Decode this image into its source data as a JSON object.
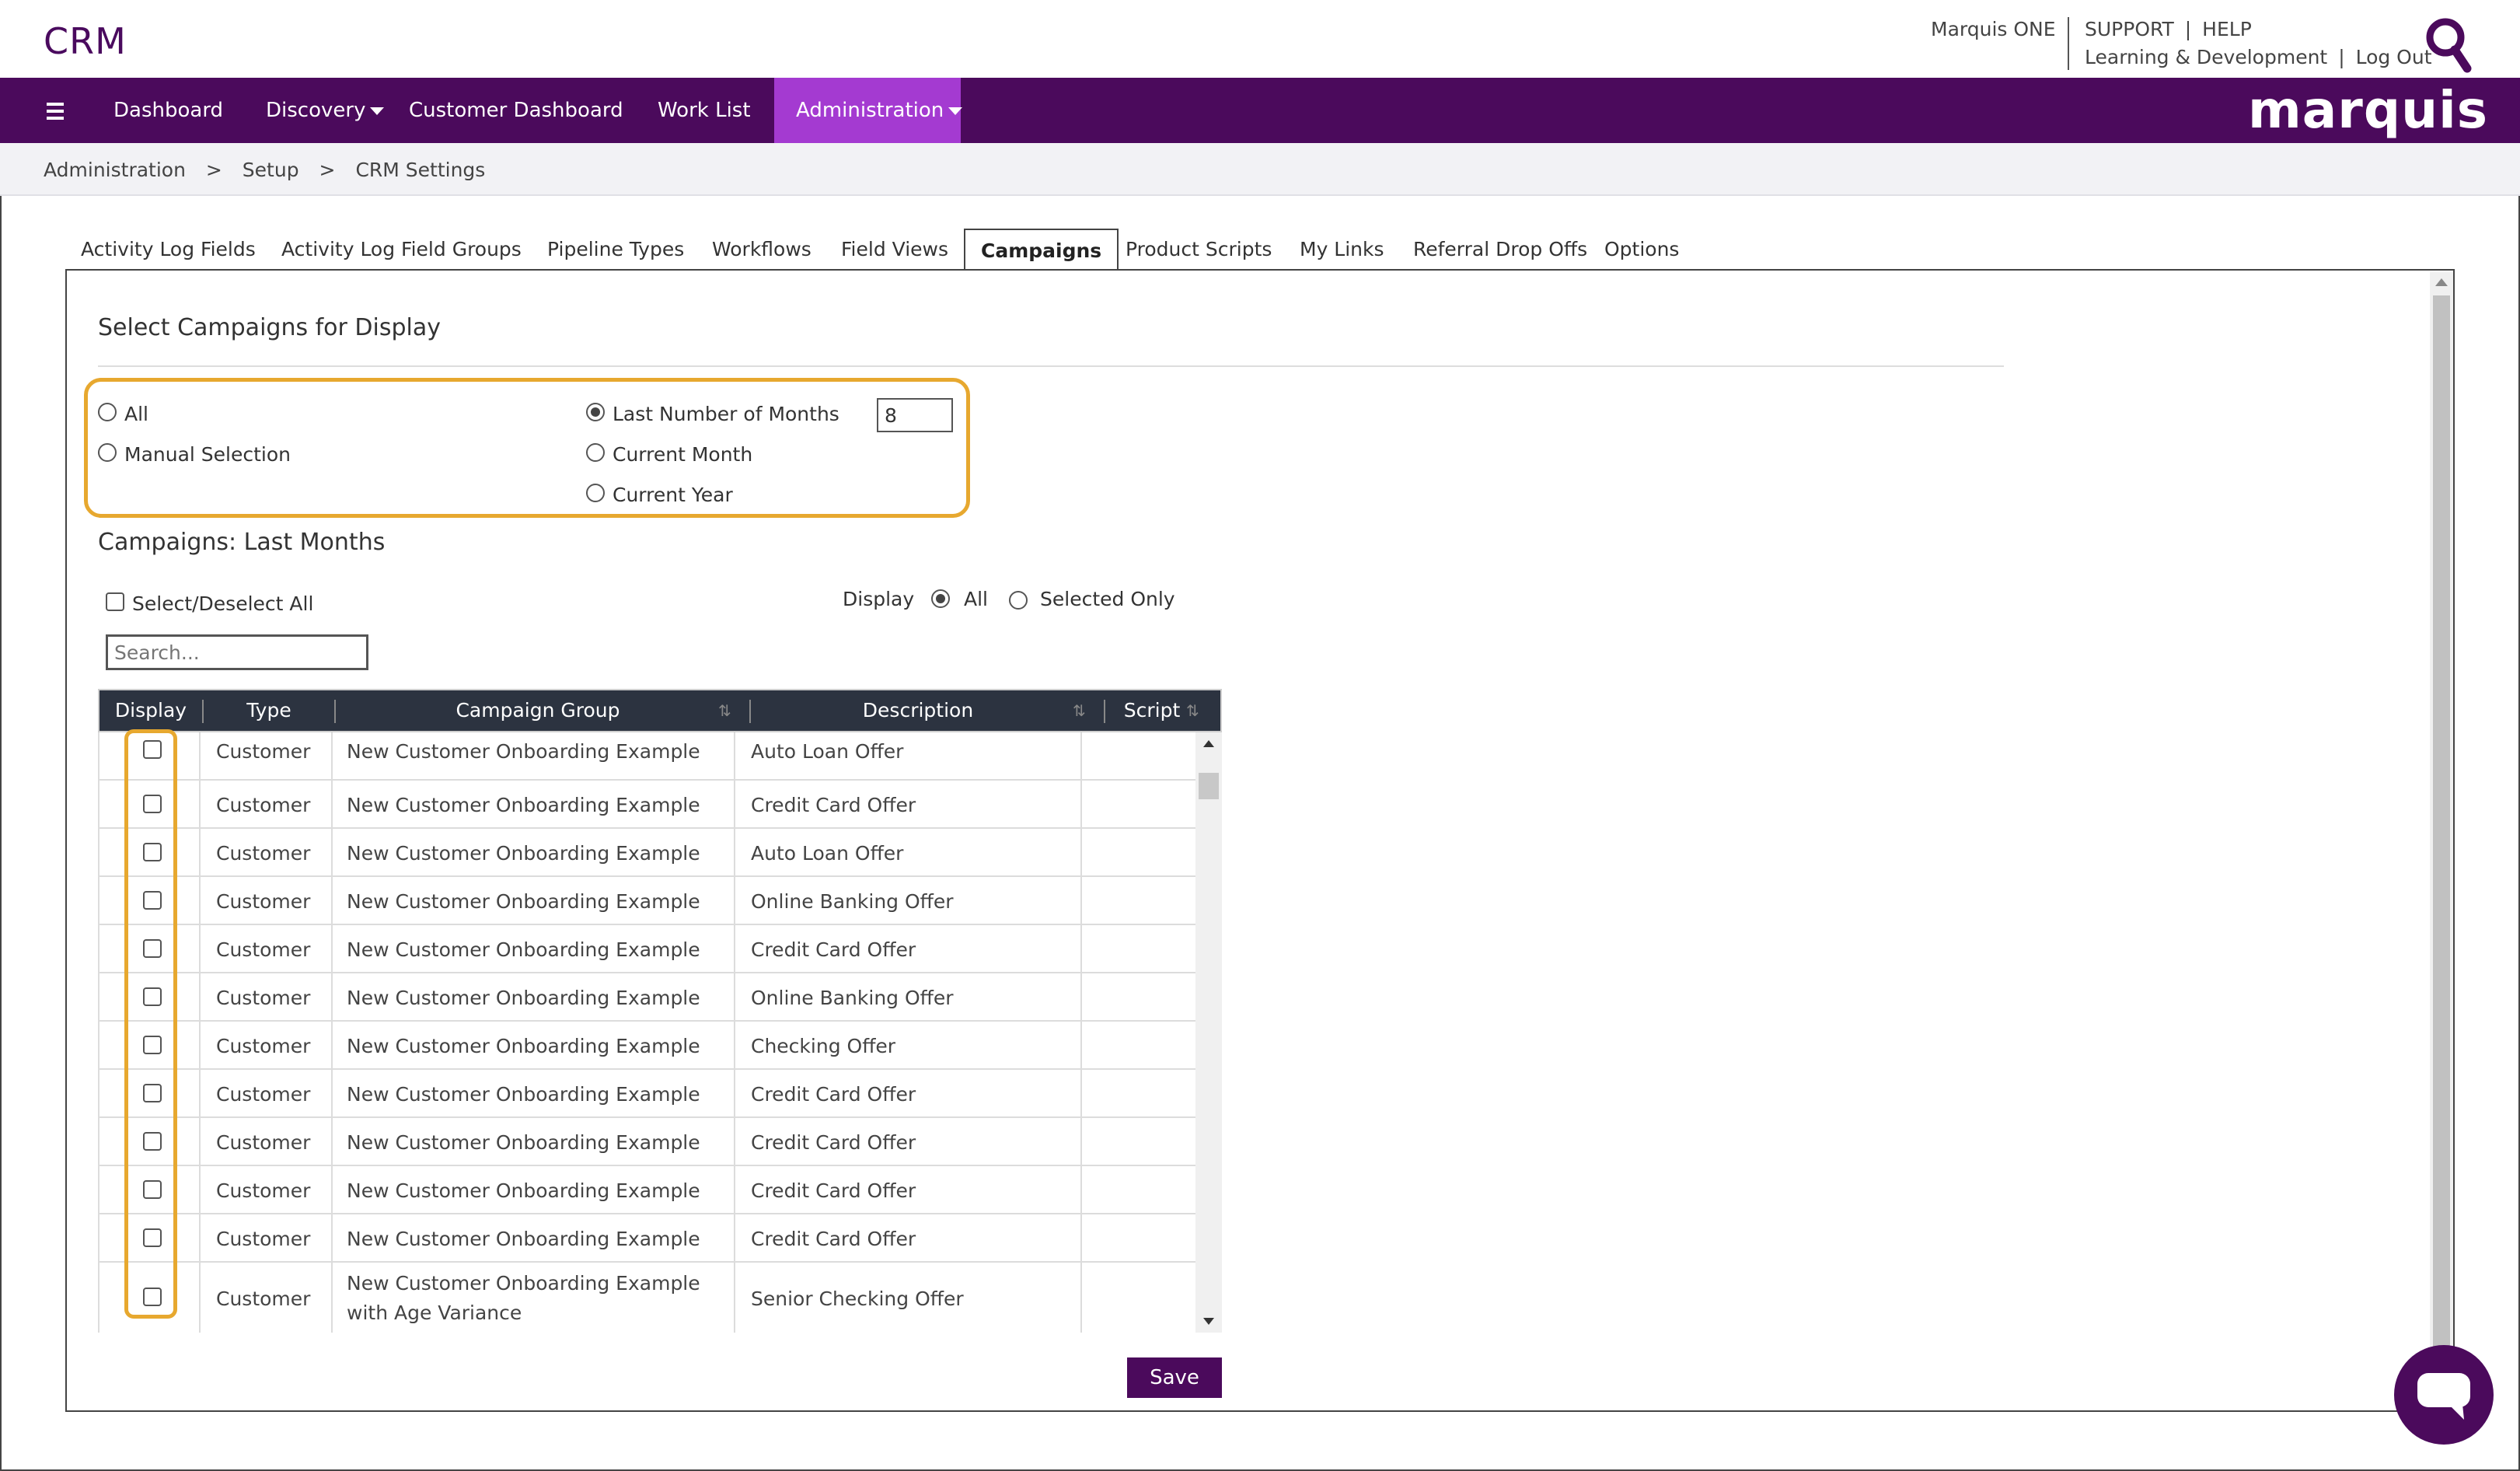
{
  "app": {
    "title": "CRM"
  },
  "top_links": {
    "product": "Marquis ONE",
    "support": "SUPPORT",
    "help": "HELP",
    "learning": "Learning & Development",
    "logout": "Log Out",
    "sep": "|"
  },
  "nav": {
    "items": [
      {
        "label": "Dashboard"
      },
      {
        "label": "Discovery"
      },
      {
        "label": "Customer Dashboard"
      },
      {
        "label": "Work List"
      },
      {
        "label": "Administration"
      }
    ],
    "logo": "marquis"
  },
  "breadcrumb": {
    "items": [
      "Administration",
      "Setup",
      "CRM Settings"
    ],
    "sep": ">"
  },
  "tabs": [
    "Activity Log Fields",
    "Activity Log Field Groups",
    "Pipeline Types",
    "Workflows",
    "Field Views",
    "Campaigns",
    "Product Scripts",
    "My Links",
    "Referral Drop Offs",
    "Options"
  ],
  "section": {
    "title": "Select Campaigns for Display",
    "options": {
      "all": "All",
      "manual": "Manual Selection",
      "last_months": "Last Number of Months",
      "current_month": "Current Month",
      "current_year": "Current Year",
      "months_value": "8"
    }
  },
  "campaigns": {
    "title": "Campaigns: Last Months",
    "select_all": "Select/Deselect All",
    "display_label": "Display",
    "display_all": "All",
    "display_selected": "Selected Only",
    "search_placeholder": "Search...",
    "columns": [
      "Display",
      "Type",
      "Campaign Group",
      "Description",
      "Script"
    ],
    "rows": [
      {
        "type": "Customer",
        "group": "New Customer Onboarding Example",
        "description": "Auto Loan Offer"
      },
      {
        "type": "Customer",
        "group": "New Customer Onboarding Example",
        "description": "Credit Card Offer"
      },
      {
        "type": "Customer",
        "group": "New Customer Onboarding Example",
        "description": "Auto Loan Offer"
      },
      {
        "type": "Customer",
        "group": "New Customer Onboarding Example",
        "description": "Online Banking Offer"
      },
      {
        "type": "Customer",
        "group": "New Customer Onboarding Example",
        "description": "Credit Card Offer"
      },
      {
        "type": "Customer",
        "group": "New Customer Onboarding Example",
        "description": "Online Banking Offer"
      },
      {
        "type": "Customer",
        "group": "New Customer Onboarding Example",
        "description": "Checking Offer"
      },
      {
        "type": "Customer",
        "group": "New Customer Onboarding Example",
        "description": "Credit Card Offer"
      },
      {
        "type": "Customer",
        "group": "New Customer Onboarding Example",
        "description": "Credit Card Offer"
      },
      {
        "type": "Customer",
        "group": "New Customer Onboarding Example",
        "description": "Credit Card Offer"
      },
      {
        "type": "Customer",
        "group": "New Customer Onboarding Example",
        "description": "Credit Card Offer"
      },
      {
        "type": "Customer",
        "group": "New Customer Onboarding Example with Age Variance",
        "description": "Senior Checking Offer"
      }
    ],
    "save_label": "Save"
  },
  "colors": {
    "brand_purple": "#4b0a5c",
    "active_nav": "#a43ad1",
    "highlight": "#e7a82f",
    "table_header": "#2c3340"
  },
  "icons": [
    "hamburger-icon",
    "search-icon",
    "chevron-down-icon",
    "sort-icon",
    "chat-icon"
  ]
}
